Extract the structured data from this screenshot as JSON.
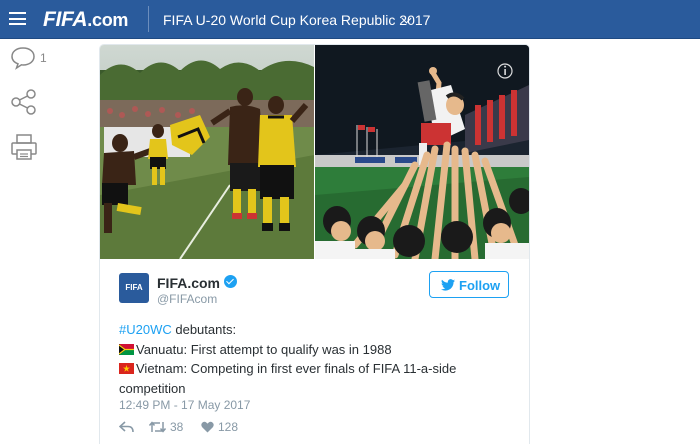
{
  "header": {
    "logo_main": "FIFA",
    "logo_suffix": ".com",
    "event_title": "FIFA U-20 World Cup Korea Republic 2017"
  },
  "sidebar": {
    "comment_count": "1"
  },
  "tweet": {
    "author_name": "FIFA.com",
    "author_handle": "@FIFAcom",
    "avatar_text": "FIFA",
    "follow_label": "Follow",
    "hashtag": "#U20WC",
    "line1_rest": " debutants:",
    "line2": "Vanuatu: First attempt to qualify was in 1988",
    "line3": "Vietnam: Competing in first ever finals of FIFA 11-a-side competition",
    "timestamp": "12:49 PM - 17 May 2017",
    "retweets": "38",
    "likes": "128"
  },
  "colors": {
    "header_bg": "#2a5b9c",
    "twitter_blue": "#1da1f2",
    "muted": "#8899a6"
  }
}
